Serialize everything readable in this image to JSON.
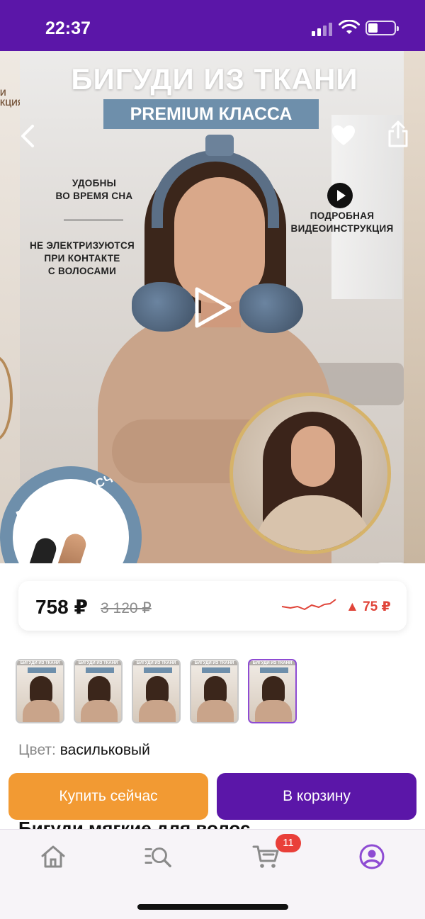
{
  "status_bar": {
    "time": "22:37",
    "icons": [
      "signal-icon",
      "wifi-icon",
      "battery-icon"
    ],
    "battery_level": 0.3
  },
  "hero": {
    "title_line1": "БИГУДИ ИЗ ТКАНИ",
    "title_line2": "PREMIUM КЛАССА",
    "feature_sleep": "УДОБНЫ\nВО ВРЕМЯ СНА",
    "feature_static": "НЕ ЭЛЕКТРИЗУЮТСЯ\nПРИ КОНТАКТЕ\nС ВОЛОСАМИ",
    "feature_video": "ПОДРОБНАЯ\nВИДЕОИНСТРУКЦИЯ",
    "gift_text": "ПОДАРОК РАСЧЕСКА",
    "side_fragment": "И\nКЦИЯ"
  },
  "price": {
    "current": "758 ₽",
    "old": "3 120 ₽",
    "delta": "▲ 75 ₽"
  },
  "thumbnails": [
    {
      "label": "БИГУДИ ИЗ ТКАНИ",
      "active": false
    },
    {
      "label": "БИГУДИ ИЗ ТКАНИ",
      "active": false
    },
    {
      "label": "БИГУДИ ИЗ ТКАНИ",
      "active": false
    },
    {
      "label": "БИГУДИ ИЗ ТКАНИ",
      "active": false
    },
    {
      "label": "БИГУДИ ИЗ ТКАНИ",
      "active": true
    }
  ],
  "color": {
    "label": "Цвет:",
    "value": "васильковый"
  },
  "actions": {
    "buy_now": "Купить сейчас",
    "add_to_cart": "В корзину"
  },
  "product": {
    "title": "Бигуди мягкие для волос"
  },
  "tabbar": {
    "cart_badge": "11"
  },
  "colors": {
    "brand": "#5b16a8",
    "buy": "#f29a33",
    "price_up": "#e0453a",
    "accent": "#8e4bd3"
  }
}
